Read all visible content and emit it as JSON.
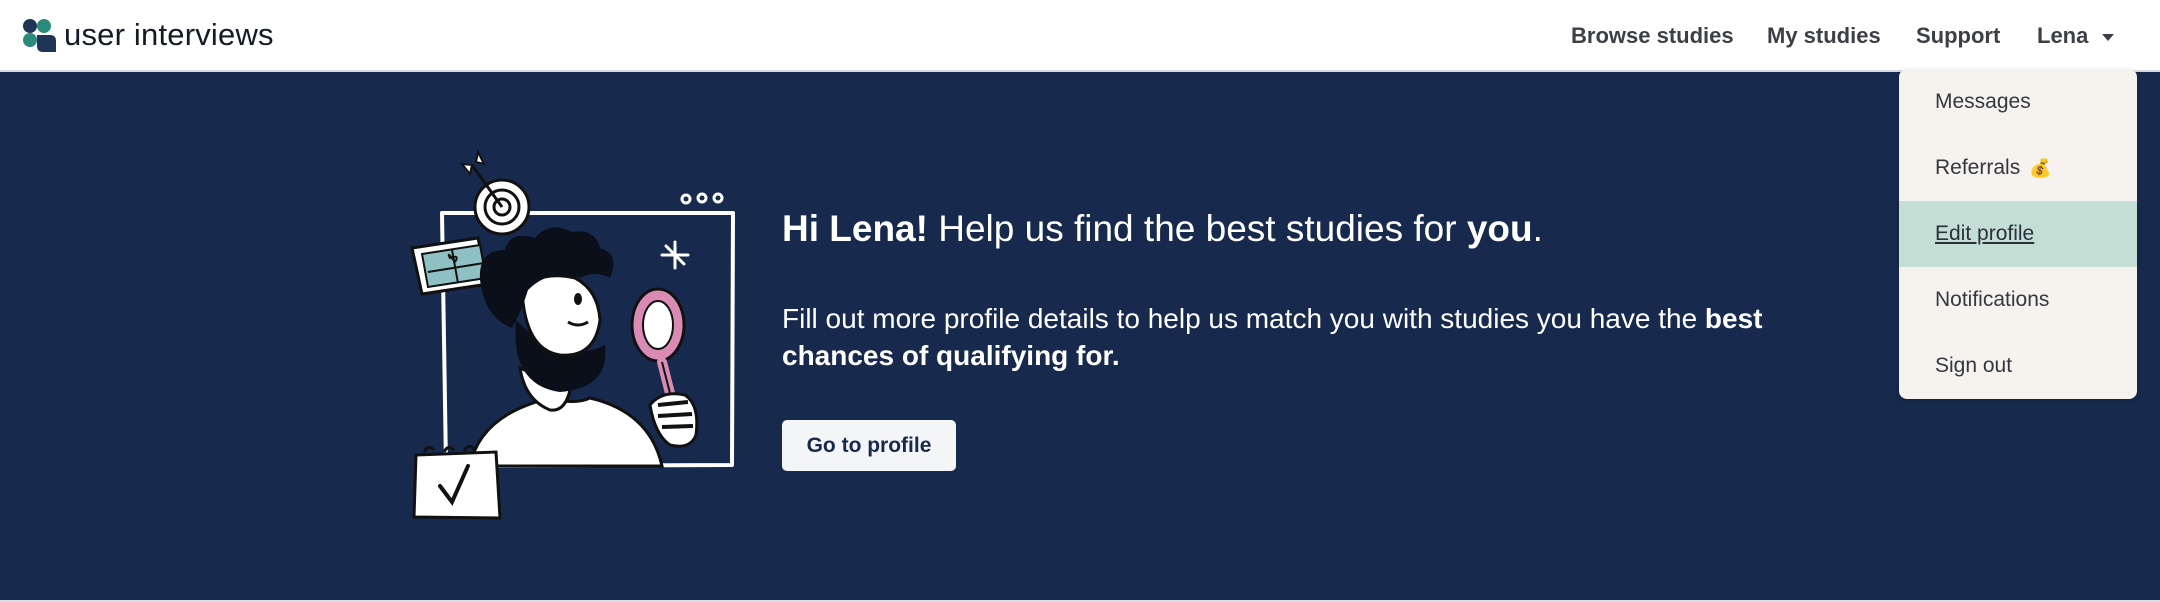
{
  "logo": {
    "brand": "user interviews",
    "icon": "user-interviews-logo-icon"
  },
  "nav": {
    "browse": "Browse studies",
    "my_studies": "My studies",
    "support": "Support",
    "user": "Lena"
  },
  "user_menu": {
    "items": [
      {
        "label": "Messages"
      },
      {
        "label": "Referrals",
        "icon": "money-bag-icon",
        "emoji": "💰"
      },
      {
        "label": "Edit profile",
        "active": true
      },
      {
        "label": "Notifications"
      },
      {
        "label": "Sign out"
      }
    ]
  },
  "hero": {
    "greeting": "Hi Lena!",
    "headline_mid": " Help us find the best studies for ",
    "headline_emph": "you",
    "headline_end": ".",
    "sub_text": "Fill out more profile details to help us match you with studies you have the ",
    "sub_bold": "best chances of qualifying for.",
    "cta": "Go to profile"
  },
  "colors": {
    "hero_bg": "#172a4d",
    "menu_bg": "#f6f3ef",
    "menu_active": "#c5ded5",
    "logo_dark": "#1e3558",
    "logo_teal": "#2b8a7a",
    "illus_pink": "#d98bb4",
    "illus_teal": "#8fc0c3"
  }
}
